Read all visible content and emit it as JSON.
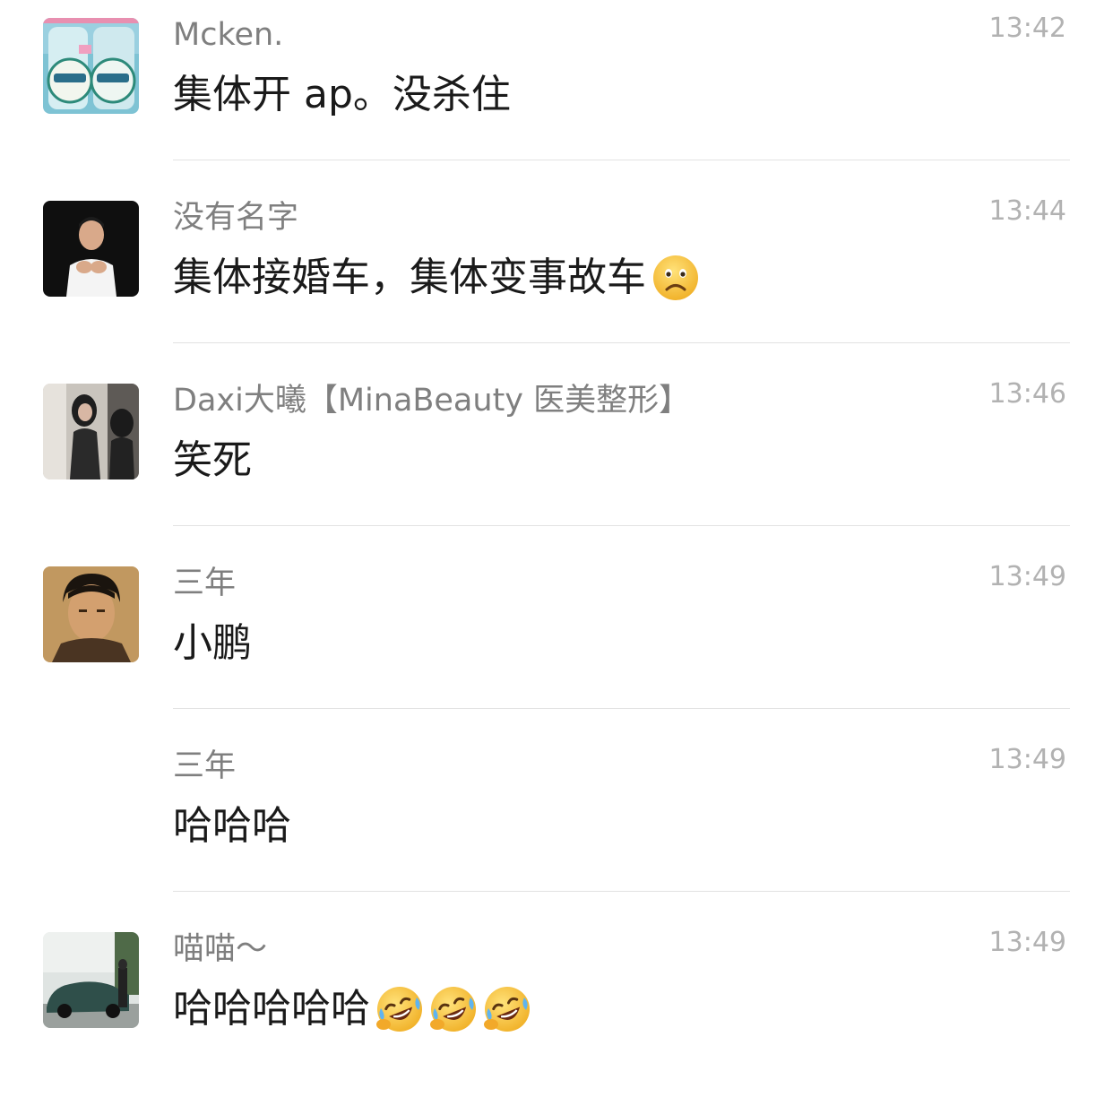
{
  "comments": [
    {
      "username": "Mcken.",
      "time": "13:42",
      "text": "集体开 ap。没杀住",
      "emoji": [],
      "avatar": "cans-photo"
    },
    {
      "username": "没有名字",
      "time": "13:44",
      "text": "集体接婚车，集体变事故车",
      "emoji": [
        "frowning-face"
      ],
      "avatar": "man-portrait-dark"
    },
    {
      "username": "Daxi大曦【MinaBeauty 医美整形】",
      "time": "13:46",
      "text": "笑死",
      "emoji": [],
      "avatar": "woman-mirror-selfie"
    },
    {
      "username": "三年",
      "time": "13:49",
      "text": "小鹏",
      "emoji": [],
      "avatar": "man-portrait-vintage"
    },
    {
      "username": "三年",
      "time": "13:49",
      "text": "哈哈哈",
      "emoji": [],
      "avatar": null
    },
    {
      "username": "喵喵～",
      "time": "13:49",
      "text": "哈哈哈哈哈",
      "emoji": [
        "rolling-laughing-face",
        "rolling-laughing-face",
        "rolling-laughing-face"
      ],
      "avatar": "car-photo"
    }
  ],
  "colors": {
    "username": "#7f7f7f",
    "timestamp": "#b2b2b2",
    "message": "#1a1a1a",
    "divider": "#e2e2e2",
    "emoji_face": "#f7c33b"
  }
}
